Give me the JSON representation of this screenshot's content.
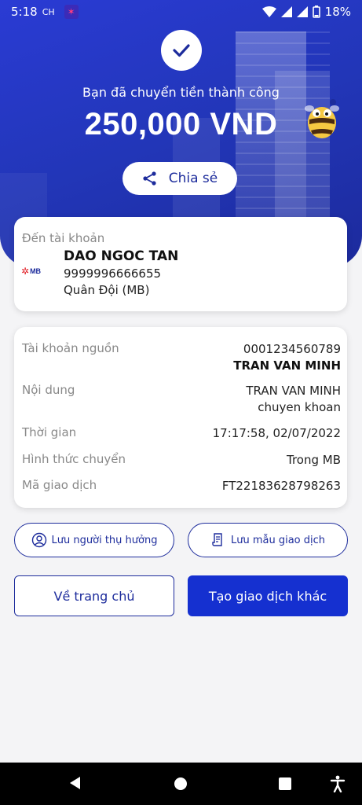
{
  "status_bar": {
    "time": "5:18",
    "ampm": "CH",
    "battery": "18%"
  },
  "hero": {
    "success_message": "Bạn đã chuyển tiền thành công",
    "amount": "250,000 VND",
    "share_label": "Chia sẻ"
  },
  "recipient": {
    "label": "Đến tài khoản",
    "bank_logo_text": "MB",
    "name": "DAO NGOC TAN",
    "account_number": "9999996666655",
    "bank": "Quân Đội (MB)"
  },
  "details": {
    "source_label": "Tài khoản nguồn",
    "source_account": "0001234560789",
    "source_name": "TRAN VAN MINH",
    "content_label": "Nội dung",
    "content_line1": "TRAN VAN MINH",
    "content_line2": "chuyen khoan",
    "time_label": "Thời gian",
    "time_value": "17:17:58, 02/07/2022",
    "method_label": "Hình thức chuyển",
    "method_value": "Trong MB",
    "txn_label": "Mã giao dịch",
    "txn_value": "FT22183628798263"
  },
  "actions": {
    "save_beneficiary": "Lưu người thụ hưởng",
    "save_template": "Lưu mẫu giao dịch",
    "home": "Về trang chủ",
    "new_transaction": "Tạo giao dịch khác"
  },
  "colors": {
    "primary": "#1d2c9c",
    "button_fill": "#1530d0",
    "hero_bg": "#2236b8"
  }
}
